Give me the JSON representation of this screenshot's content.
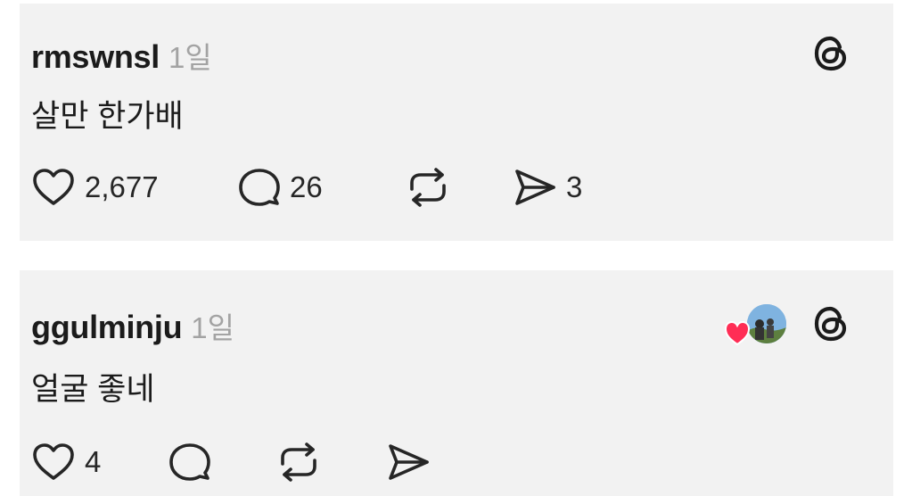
{
  "posts": [
    {
      "username": "rmswnsl",
      "time": "1일",
      "text": "살만 한가배",
      "likes": "2,677",
      "replies": "26",
      "reposts": "",
      "shares": "3"
    },
    {
      "username": "ggulminju",
      "time": "1일",
      "text": "얼굴 좋네",
      "likes": "4",
      "replies": "",
      "reposts": "",
      "shares": ""
    }
  ],
  "icons": {
    "brand": "threads-icon",
    "like": "heart-icon",
    "reply": "comment-icon",
    "repost": "repost-icon",
    "share": "send-icon"
  },
  "colors": {
    "card_bg": "#f2f2f2",
    "page_bg": "#ffffff",
    "username": "#1b1b1b",
    "timestamp": "#a3a3a3",
    "liked_heart": "#ff2d55"
  }
}
